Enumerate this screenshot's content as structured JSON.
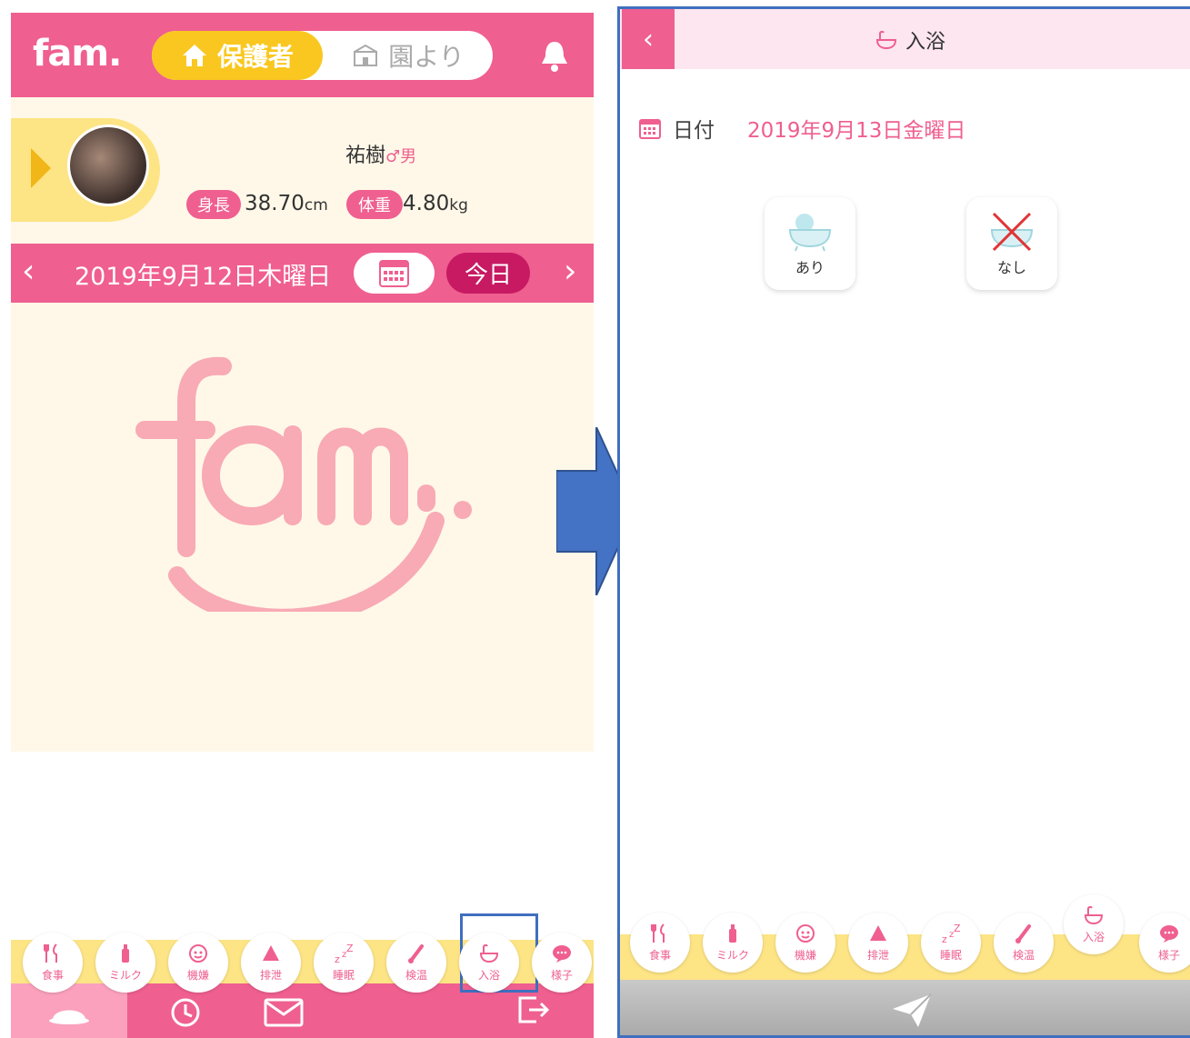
{
  "left": {
    "header": {
      "logo": "fam.",
      "tab_parent": "保護者",
      "tab_school": "園より"
    },
    "profile": {
      "name": "祐樹",
      "sex": "♂男",
      "height_label": "身長",
      "height_value": "38.70",
      "height_unit": "cm",
      "weight_label": "体重",
      "weight_value": "4.80",
      "weight_unit": "kg"
    },
    "datebar": {
      "prev": "‹",
      "date": "2019年9月12日木曜日",
      "today": "今日",
      "next": "›"
    },
    "nav": [
      {
        "label": "食事",
        "icon": "utensils-icon"
      },
      {
        "label": "ミルク",
        "icon": "bottle-icon"
      },
      {
        "label": "機嫌",
        "icon": "baby-face-icon"
      },
      {
        "label": "排泄",
        "icon": "poop-icon"
      },
      {
        "label": "睡眠",
        "icon": "sleep-zzz-icon"
      },
      {
        "label": "検温",
        "icon": "thermometer-icon"
      },
      {
        "label": "入浴",
        "icon": "bathtub-icon"
      },
      {
        "label": "様子",
        "icon": "chat-bubble-icon"
      }
    ]
  },
  "right": {
    "header": {
      "back": "‹",
      "title": "入浴"
    },
    "date_label": "日付",
    "date_value": "2019年9月13日金曜日",
    "options": [
      {
        "label": "あり"
      },
      {
        "label": "なし"
      }
    ],
    "nav": [
      {
        "label": "食事"
      },
      {
        "label": "ミルク"
      },
      {
        "label": "機嫌"
      },
      {
        "label": "排泄"
      },
      {
        "label": "睡眠"
      },
      {
        "label": "検温"
      },
      {
        "label": "入浴"
      },
      {
        "label": "様子"
      }
    ]
  },
  "colors": {
    "pink": "#ef5f8f",
    "yellow": "#fde485",
    "cream": "#fff8e8",
    "highlight_blue": "#3f6fbf"
  }
}
